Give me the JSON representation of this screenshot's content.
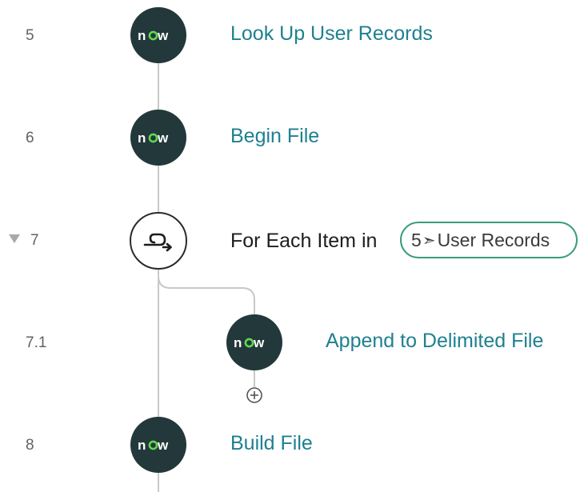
{
  "flow": {
    "steps": [
      {
        "number": "5",
        "title": "Look Up User Records",
        "icon": "servicenow-now-logo"
      },
      {
        "number": "6",
        "title": "Begin File",
        "icon": "servicenow-now-logo"
      },
      {
        "number": "7",
        "title": "For Each Item in",
        "icon": "loop-icon",
        "expanded": true,
        "data_pill": {
          "step_ref": "5",
          "arrow": "➣",
          "label": "User Records"
        }
      },
      {
        "number": "7.1",
        "title": "Append to Delimited File",
        "icon": "servicenow-now-logo"
      },
      {
        "number": "8",
        "title": "Build File",
        "icon": "servicenow-now-logo"
      }
    ],
    "add_step_icon": "plus-circle-icon"
  },
  "colors": {
    "node_fill": "#23383a",
    "logo_white": "#ffffff",
    "logo_green": "#62d84e",
    "link_teal": "#1f8090",
    "pill_border": "#3a9e76",
    "connector": "#c8c8c8"
  }
}
